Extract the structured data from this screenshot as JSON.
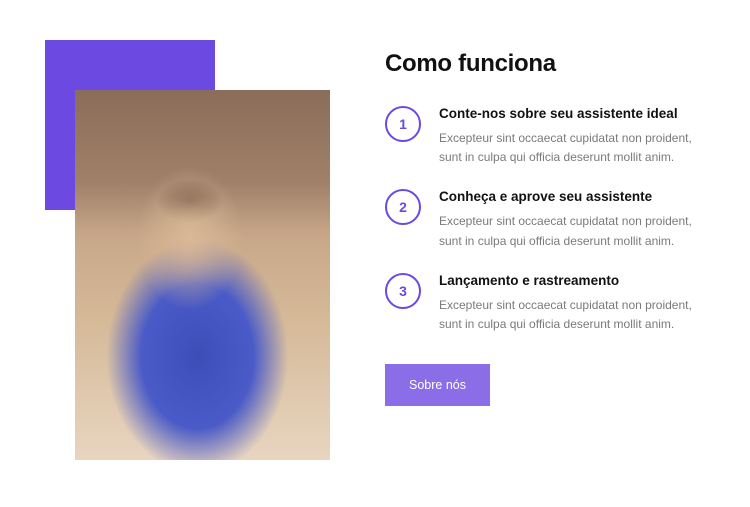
{
  "heading": "Como funciona",
  "steps": [
    {
      "num": "1",
      "title": "Conte-nos sobre seu assistente ideal",
      "desc": "Excepteur sint occaecat cupidatat non proident, sunt in culpa qui officia deserunt mollit anim."
    },
    {
      "num": "2",
      "title": "Conheça e aprove seu assistente",
      "desc": "Excepteur sint occaecat cupidatat non proident, sunt in culpa qui officia deserunt mollit anim."
    },
    {
      "num": "3",
      "title": "Lançamento e rastreamento",
      "desc": "Excepteur sint occaecat cupidatat non proident, sunt in culpa qui officia deserunt mollit anim."
    }
  ],
  "button": "Sobre nós"
}
